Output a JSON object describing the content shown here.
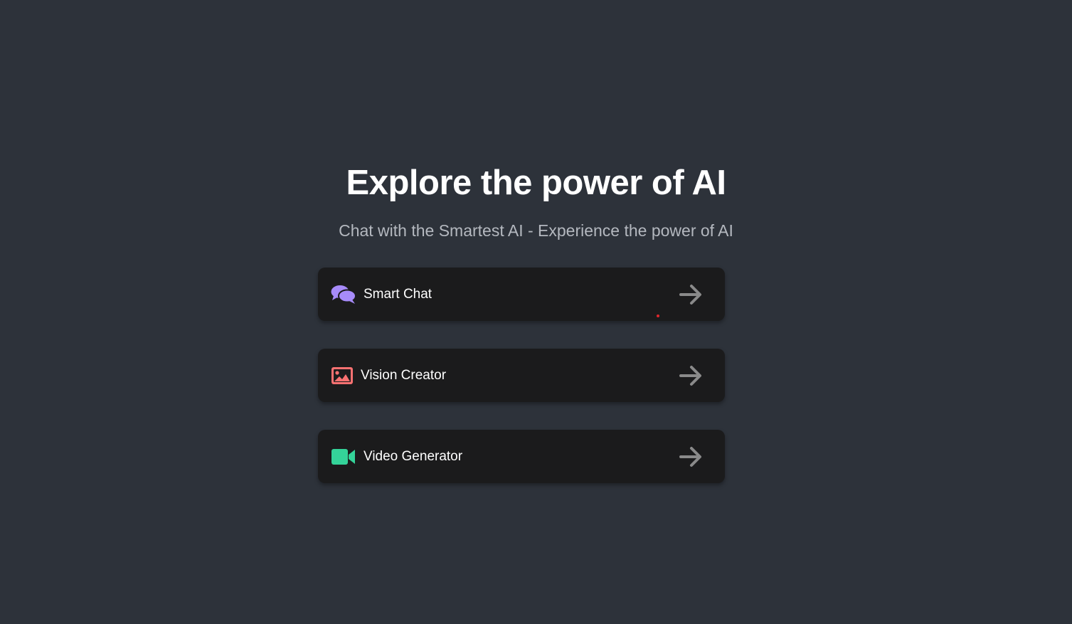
{
  "hero": {
    "title": "Explore the power of AI",
    "subtitle": "Chat with the Smartest AI - Experience the power of AI"
  },
  "cards": [
    {
      "label": "Smart Chat",
      "icon": "chat-bubbles-icon",
      "icon_color": "#a78bfa"
    },
    {
      "label": "Vision Creator",
      "icon": "image-icon",
      "icon_color": "#f87171"
    },
    {
      "label": "Video Generator",
      "icon": "video-camera-icon",
      "icon_color": "#34d399"
    }
  ],
  "colors": {
    "background": "#2d323a",
    "card": "#1b1b1c",
    "arrow": "#8a8a8a",
    "cursor_dot": "#e0262b"
  }
}
